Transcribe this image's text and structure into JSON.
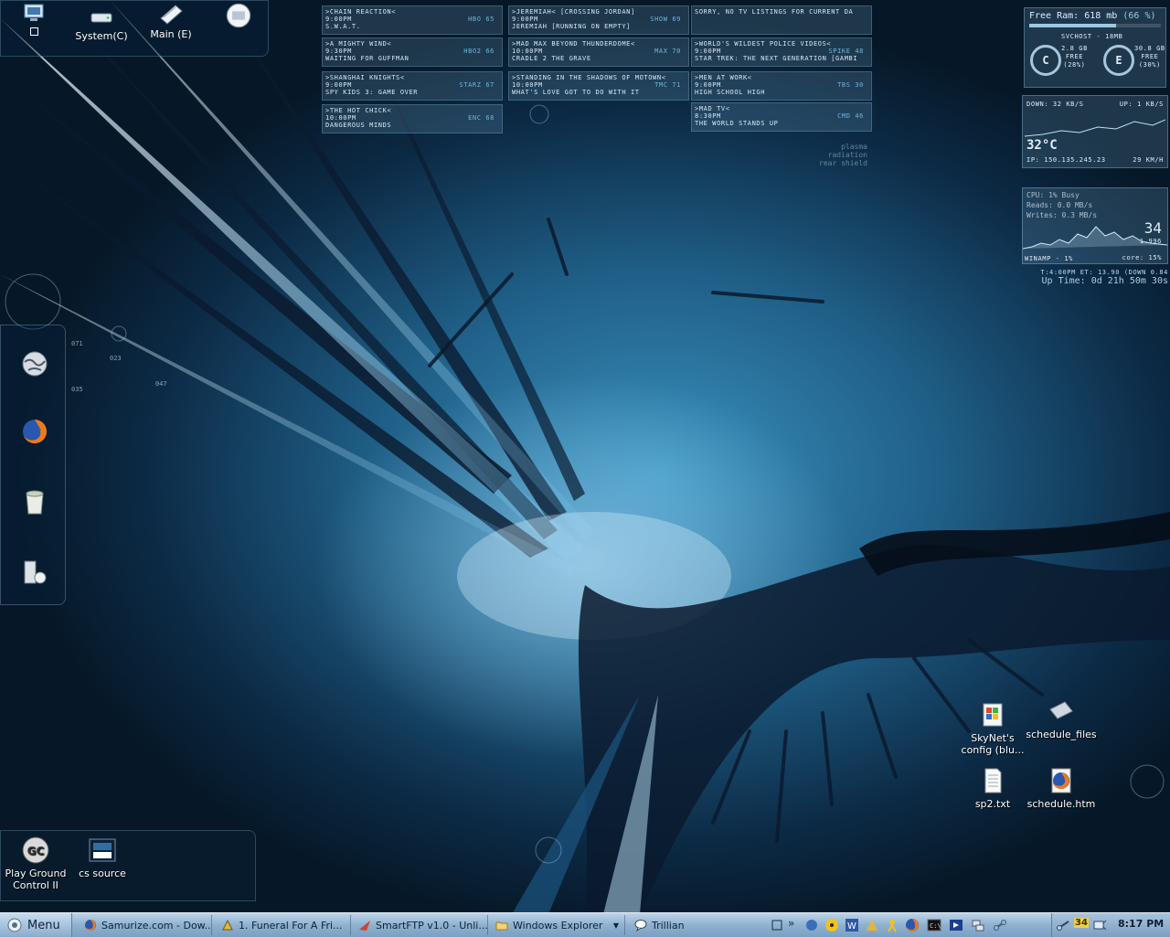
{
  "top_bar": {
    "icons": [
      {
        "label": "",
        "icon": "computer-icon"
      },
      {
        "label": "System(C)",
        "icon": "drive-icon"
      },
      {
        "label": "Main (E)",
        "icon": "book-drive-icon"
      },
      {
        "label": "",
        "icon": "network-globe-icon"
      }
    ]
  },
  "tv_listings": [
    [
      ">CHAIN REACTION<",
      "9:00PM",
      "S.W.A.T.",
      "HBO 65"
    ],
    [
      ">JEREMIAH< [CROSSING JORDAN]",
      "9:00PM",
      "JEREMIAH [RUNNING ON EMPTY]",
      "SHOW 69"
    ],
    [
      "SORRY, NO TV LISTINGS FOR CURRENT DA",
      "",
      "",
      ""
    ],
    [
      ">A MIGHTY WIND<",
      "9:30PM",
      "WAITING FOR GUFFMAN",
      "HBO2 66"
    ],
    [
      ">MAD MAX BEYOND THUNDERDOME<",
      "10:00PM",
      "CRADLE 2 THE GRAVE",
      "MAX 70"
    ],
    [
      ">WORLD'S WILDEST POLICE VIDEOS<",
      "9:00PM",
      "STAR TREK: THE NEXT GENERATION [GAMBI",
      "SPIKE 48"
    ],
    [
      ">SHANGHAI KNIGHTS<",
      "9:00PM",
      "SPY KIDS 3: GAME OVER",
      "STARZ 67"
    ],
    [
      ">STANDING IN THE SHADOWS OF MOTOWN<",
      "10:00PM",
      "WHAT'S LOVE GOT TO DO WITH IT",
      "TMC 71"
    ],
    [
      ">MEN AT WORK<",
      "9:00PM",
      "HIGH SCHOOL HIGH",
      "TBS 30"
    ],
    [
      ">THE HOT CHICK<",
      "10:00PM",
      "DANGEROUS MINDS",
      "ENC 68"
    ],
    [
      "",
      "",
      "",
      ""
    ],
    [
      ">MAD TV<",
      "8:30PM",
      "THE WORLD STANDS UP",
      "CMD 46"
    ]
  ],
  "system": {
    "free_ram": "Free Ram: 618 mb",
    "free_ram_pct": "(66 %)",
    "process": "SVCHOST - 18MB",
    "drive_c": {
      "letter": "C",
      "free_size": "2.8 GB",
      "free_label": "FREE",
      "pct": "(28%)"
    },
    "drive_e": {
      "letter": "E",
      "free_size": "30.8 GB",
      "free_label": "FREE",
      "pct": "(30%)"
    },
    "down": "DOWN: 32 KB/S",
    "up": "UP: 1 KB/S",
    "temp": "32°C",
    "ip": "IP: 150.135.245.23",
    "wind": "29 KM/H",
    "cpu": "CPU: 1% Busy",
    "reads": "Reads: 0.0 MB/s",
    "writes": "Writes: 0.3 MB/s",
    "big_num": "34",
    "small_num": "1.996",
    "winamp": "WINAMP - 1%",
    "core": "core: 15%",
    "timer": "T:4:00PM  ET: 13.90  (DOWN 0.84",
    "uptime": "Up Time: 0d 21h 50m 30s",
    "faint_text": [
      "plasma",
      "radiation",
      "rear shield"
    ]
  },
  "hud_numbers": [
    "071",
    "023",
    "035",
    "047"
  ],
  "left_dock": [
    {
      "icon": "globe-icon"
    },
    {
      "icon": "firefox-icon"
    },
    {
      "icon": "recycle-bin-icon"
    },
    {
      "icon": "computer-tower-icon"
    }
  ],
  "desktop_icons": [
    {
      "label": "SkyNet's config (blu...",
      "icon": "windows-file-icon"
    },
    {
      "label": "schedule_files",
      "icon": "folder-icon"
    },
    {
      "label": "sp2.txt",
      "icon": "text-file-icon"
    },
    {
      "label": "schedule.htm",
      "icon": "firefox-html-icon"
    }
  ],
  "launcher": [
    {
      "label": "Play Ground Control II",
      "icon": "ground-control-icon"
    },
    {
      "label": "cs source",
      "icon": "css-icon"
    }
  ],
  "taskbar": {
    "start": "Menu",
    "tasks": [
      {
        "label": "Samurize.com - Dow...",
        "icon": "firefox-icon"
      },
      {
        "label": "1. Funeral For A Fri...",
        "icon": "winamp-icon"
      },
      {
        "label": "SmartFTP v1.0 - Unli...",
        "icon": "smartftp-icon"
      },
      {
        "label": "Windows Explorer",
        "icon": "folder-icon"
      },
      {
        "label": "Trillian",
        "icon": "trillian-icon"
      }
    ],
    "clock": "8:17 PM",
    "tray_number": "34"
  },
  "colors": {
    "accent": "#6fb5dc",
    "taskbar": "#8fb1d0",
    "wallpaper_dark": "#061828"
  }
}
